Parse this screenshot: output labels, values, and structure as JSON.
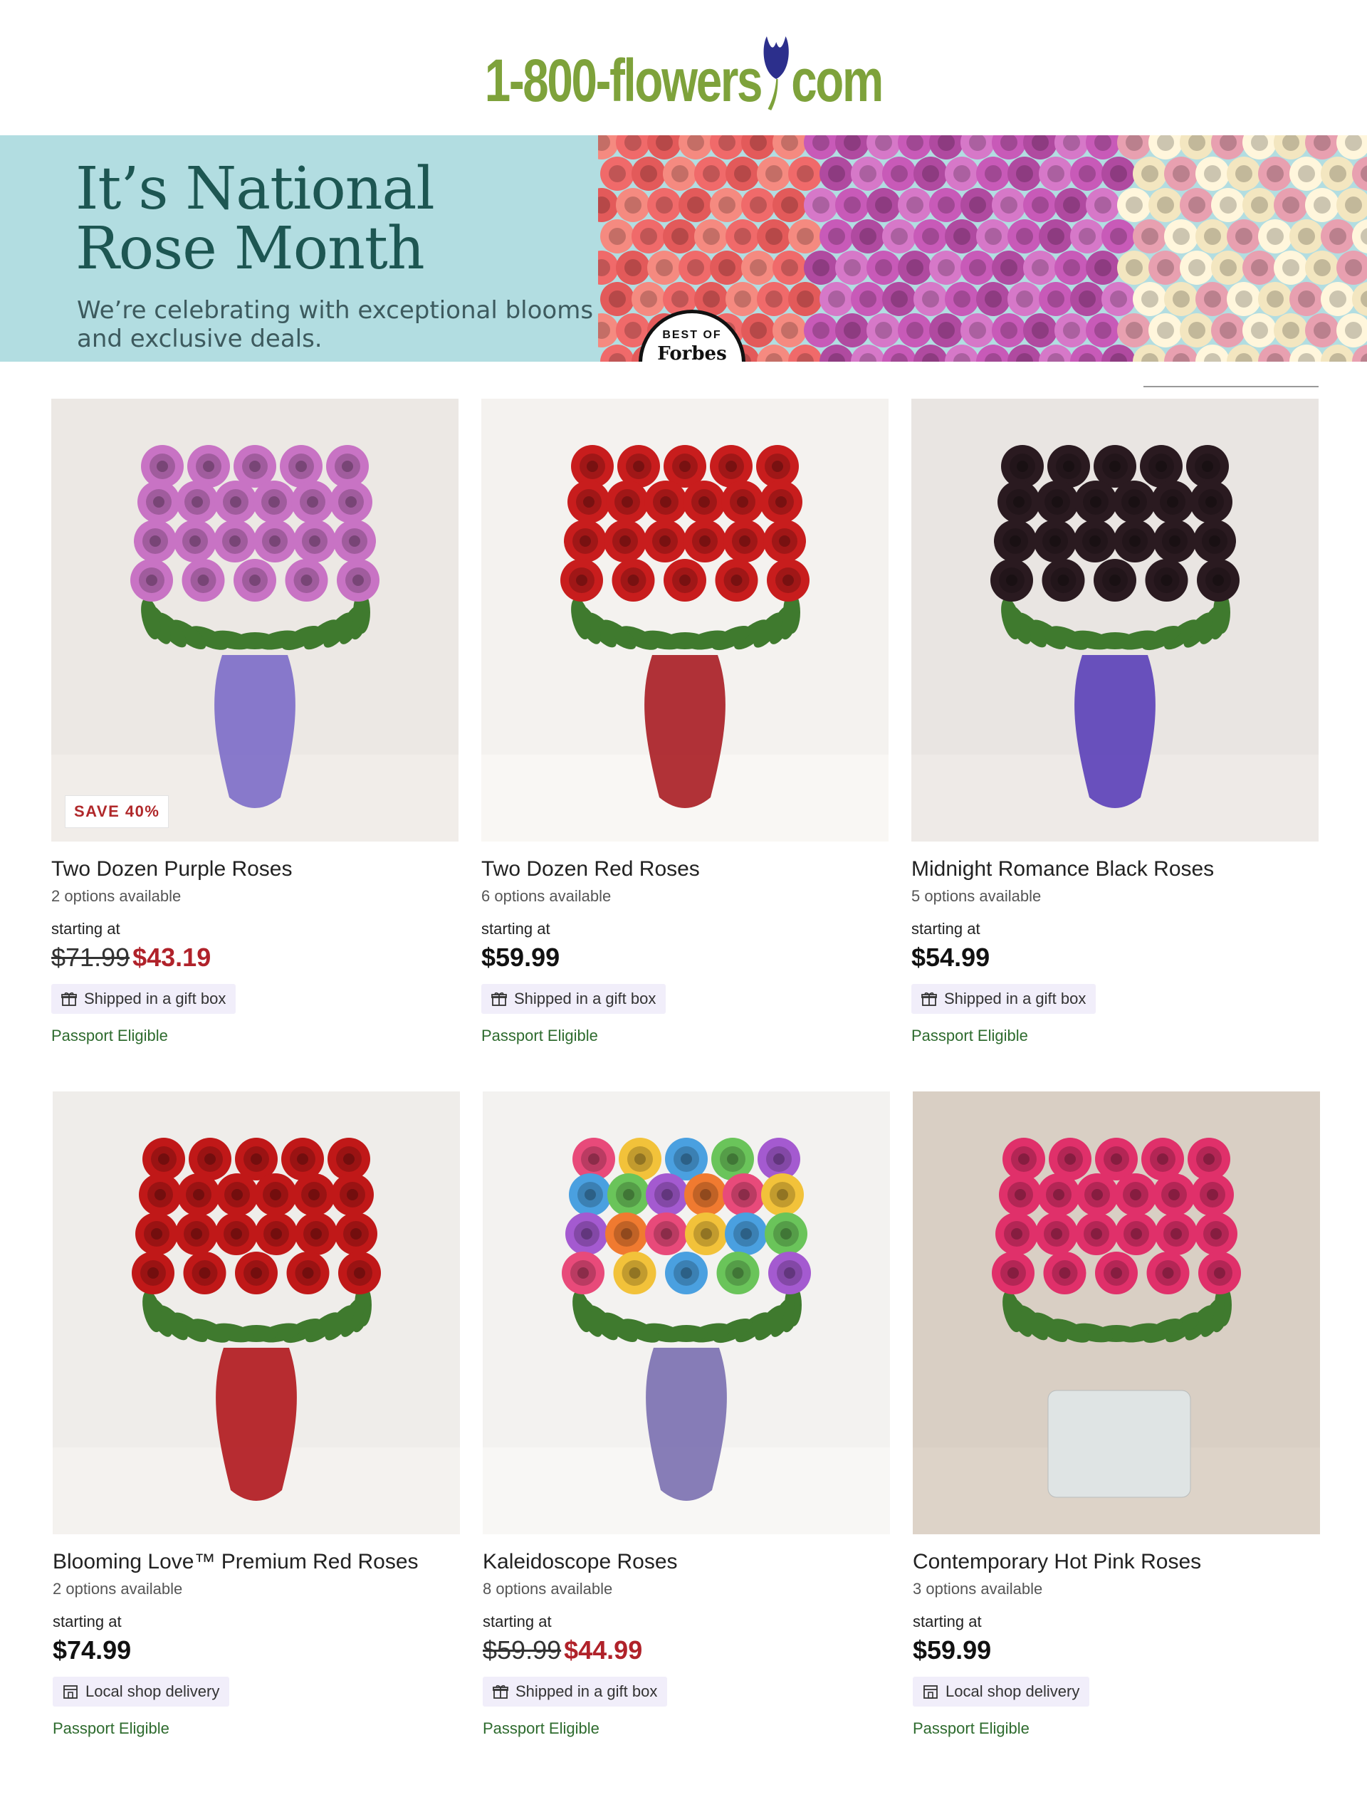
{
  "header": {
    "logo_part1": "1-800-flowers",
    "logo_part2": "com"
  },
  "banner": {
    "title_line1": "It’s National",
    "title_line2": "Rose Month",
    "subtitle_line1": "We’re celebrating with exceptional blooms",
    "subtitle_line2": "and exclusive deals.",
    "badge_best": "BEST OF",
    "badge_name": "Forbes"
  },
  "products": [
    {
      "name": "Two Dozen Purple Roses",
      "options": "2 options available",
      "starting": "starting at",
      "price_old": "$71.99",
      "price": "$43.19",
      "badge": "SAVE 40%",
      "shipping": "Shipped in a gift box",
      "passport": "Passport Eligible",
      "rose_color": "#c873c4"
    },
    {
      "name": "Two Dozen Red Roses",
      "options": "6 options available",
      "starting": "starting at",
      "price": "$59.99",
      "shipping": "Shipped in a gift box",
      "passport": "Passport Eligible",
      "rose_color": "#c81d1d"
    },
    {
      "name": "Midnight Romance Black Roses",
      "options": "5 options available",
      "starting": "starting at",
      "price": "$54.99",
      "shipping": "Shipped in a gift box",
      "passport": "Passport Eligible",
      "rose_color": "#2a1a20"
    },
    {
      "name": "Blooming Love™ Premium Red Roses",
      "options": "2 options available",
      "starting": "starting at",
      "price": "$74.99",
      "shipping": "Local shop delivery",
      "passport": "Passport Eligible",
      "rose_color": "#c01818"
    },
    {
      "name": "Kaleidoscope Roses",
      "options": "8 options available",
      "starting": "starting at",
      "price_old": "$59.99",
      "price": "$44.99",
      "shipping": "Shipped in a gift box",
      "passport": "Passport Eligible",
      "rose_color": "#e0a030"
    },
    {
      "name": "Contemporary Hot Pink Roses",
      "options": "3 options available",
      "starting": "starting at",
      "price": "$59.99",
      "shipping": "Local shop delivery",
      "passport": "Passport Eligible",
      "rose_color": "#e0306a"
    }
  ],
  "colors": {
    "sale_red": "#b0222a",
    "passport_green": "#2e6b2e",
    "banner_bg": "#b2dde1",
    "badge_bg": "#f1eefa"
  }
}
